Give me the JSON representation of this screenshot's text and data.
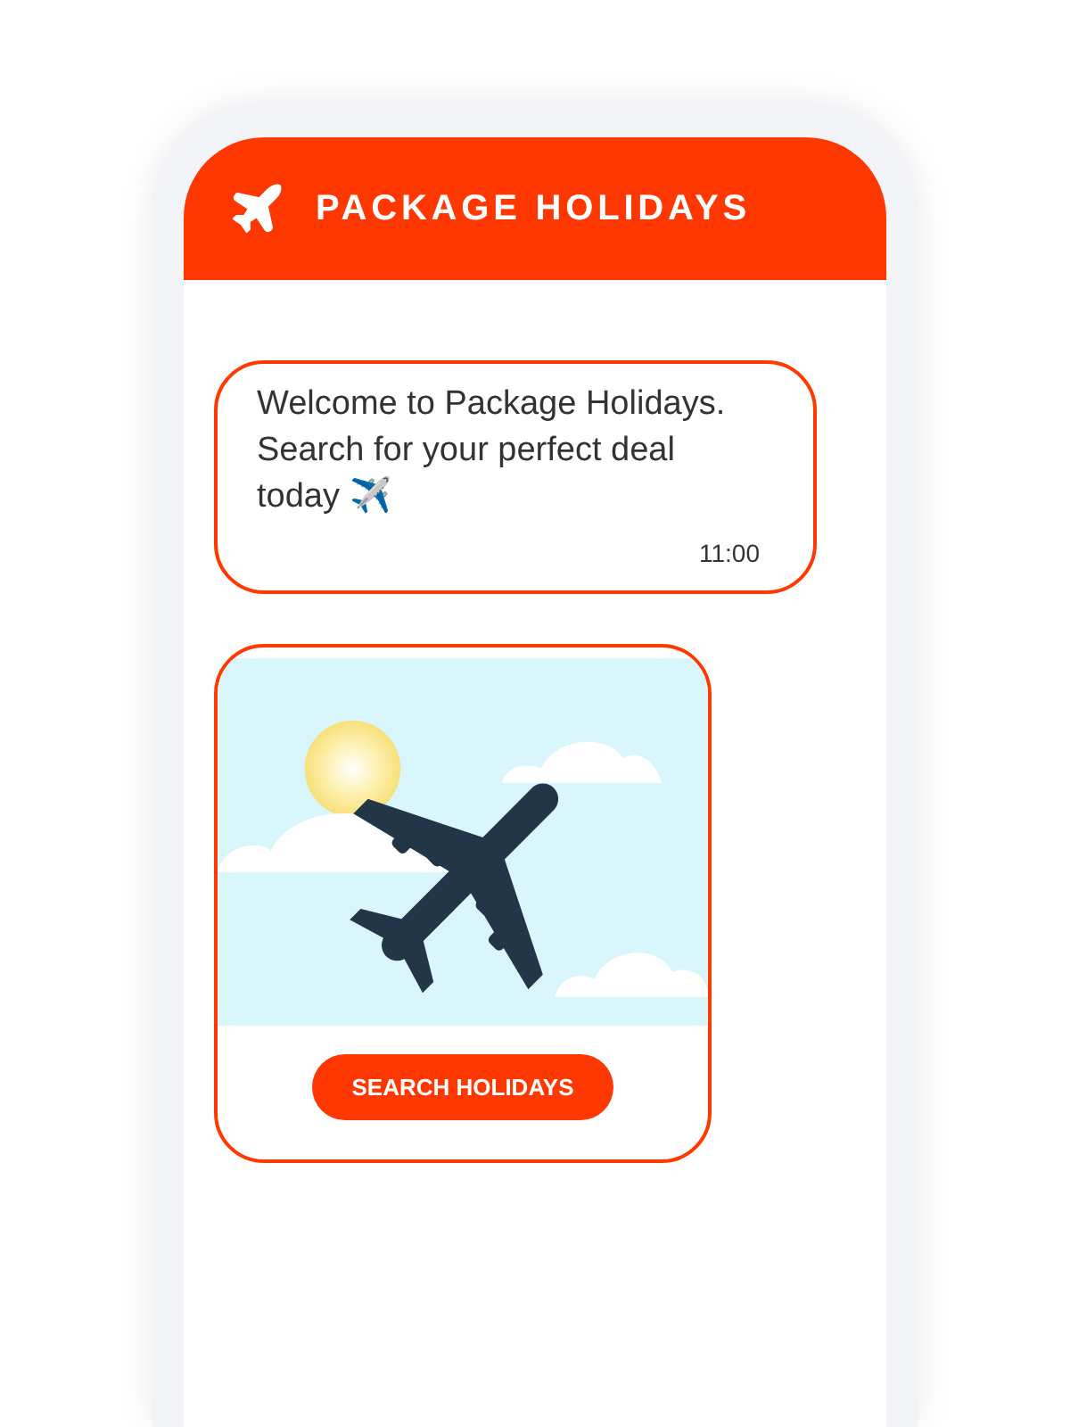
{
  "header": {
    "title": "PACKAGE HOLIDAYS"
  },
  "messages": [
    {
      "kind": "text",
      "text": "Welcome to Package Holidays. Search for your perfect deal today ✈️",
      "time": "11:00"
    },
    {
      "kind": "card",
      "button": "SEARCH HOLIDAYS"
    }
  ]
}
